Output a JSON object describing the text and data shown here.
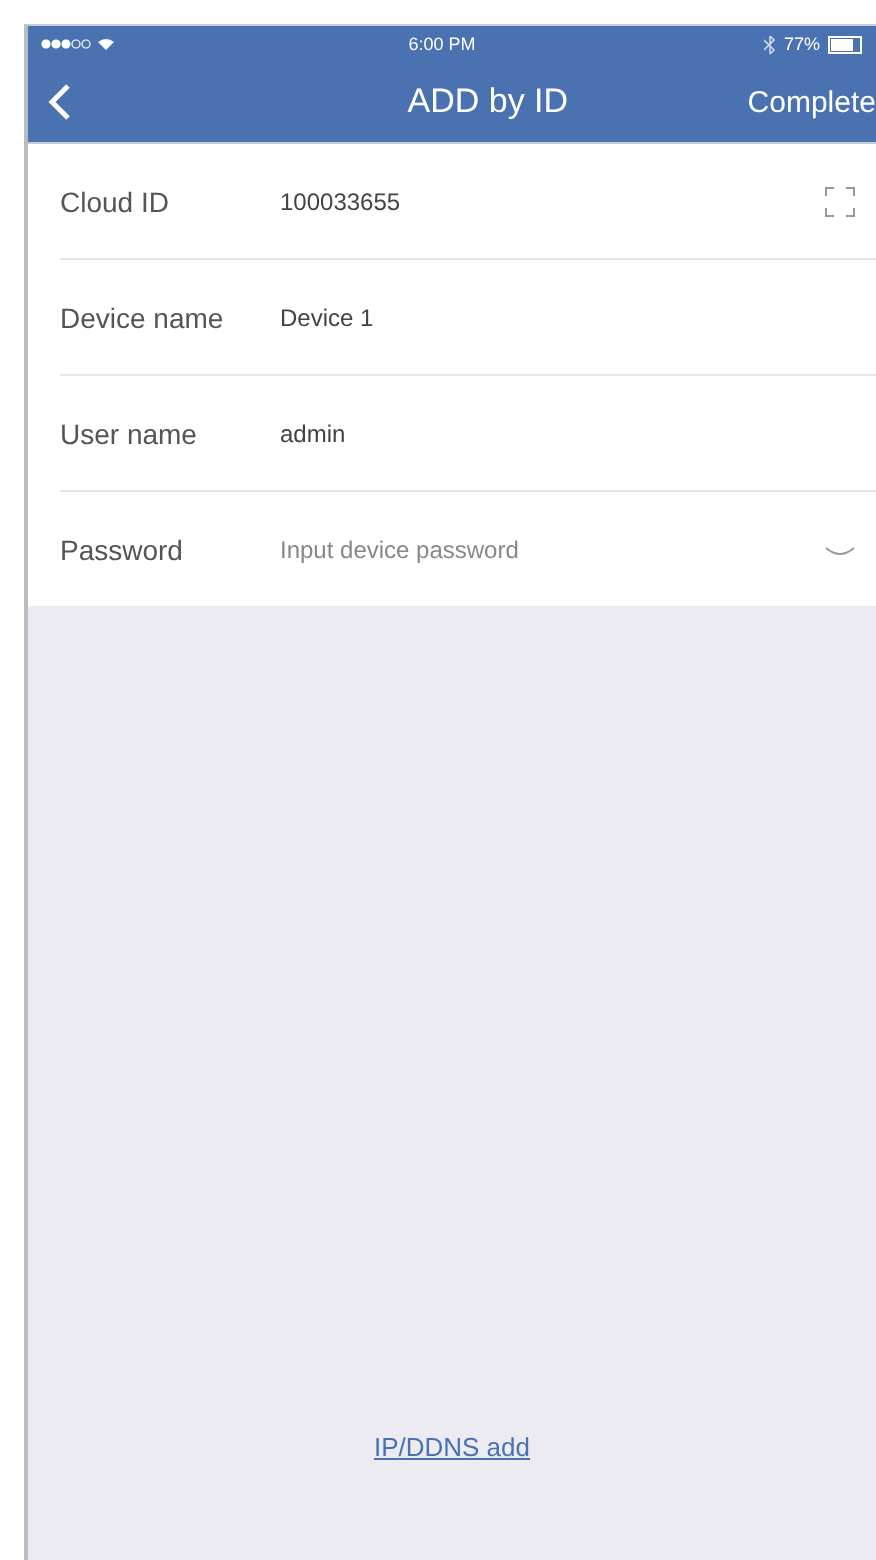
{
  "status_bar": {
    "time": "6:00 PM",
    "battery": "77%"
  },
  "nav": {
    "title": "ADD by ID",
    "action": "Complete"
  },
  "fields": [
    {
      "kind": "scan",
      "label": "Cloud ID",
      "value": "100033655"
    },
    {
      "kind": "text",
      "label": "Device name",
      "value": "Device 1"
    },
    {
      "kind": "text",
      "label": "User name",
      "value": "admin"
    },
    {
      "kind": "password",
      "label": "Password",
      "placeholder": "Input device password"
    }
  ],
  "link": "IP/DDNS add"
}
